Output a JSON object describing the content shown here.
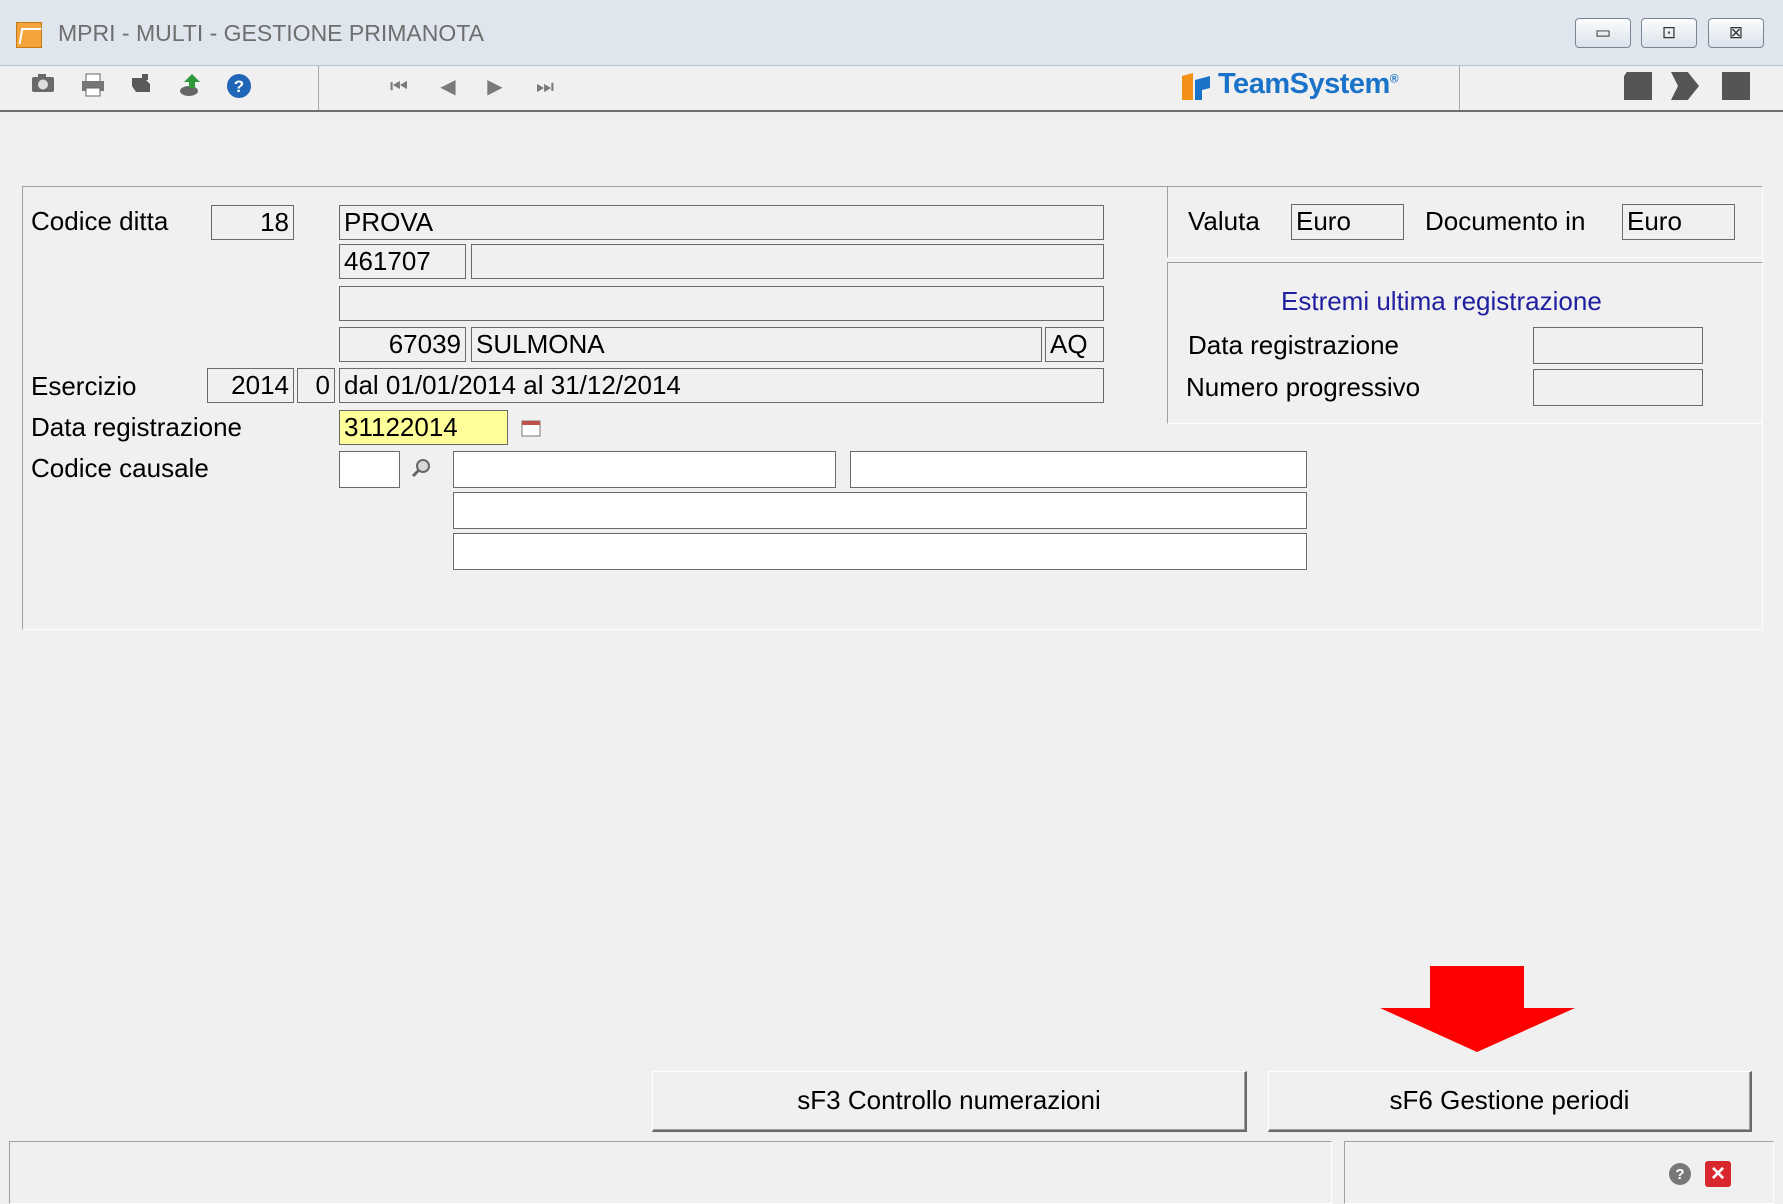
{
  "window": {
    "title": "MPRI  - MULTI -  GESTIONE PRIMANOTA",
    "minimize": "▭",
    "maximize": "⊡",
    "close": "⊠"
  },
  "toolbar": {
    "icons": [
      "camera-icon",
      "printer-icon",
      "stamp-icon",
      "export-icon",
      "help-icon"
    ],
    "nav": [
      "⏮",
      "◀",
      "▶",
      "⏭"
    ],
    "brand": "TeamSystem",
    "brand_mark": "®"
  },
  "ditta": {
    "label": "Codice ditta",
    "code": "18",
    "name": "PROVA",
    "code2": "461707",
    "code2_extra": "",
    "address": "",
    "cap": "67039",
    "city": "SULMONA",
    "province": "AQ"
  },
  "esercizio": {
    "label": "Esercizio",
    "year": "2014",
    "num": "0",
    "range": "dal 01/01/2014 al 31/12/2014"
  },
  "data_registrazione": {
    "label": "Data registrazione",
    "value": "31122014"
  },
  "causale": {
    "label": "Codice causale",
    "code": "",
    "desc1": "",
    "desc2": "",
    "desc3": "",
    "desc4": ""
  },
  "valuta": {
    "label": "Valuta",
    "value": "Euro",
    "doc_label": "Documento in",
    "doc_value": "Euro"
  },
  "ultima": {
    "title": "Estremi ultima registrazione",
    "data_label": "Data registrazione",
    "data_value": "",
    "numero_label": "Numero progressivo",
    "numero_value": ""
  },
  "buttons": {
    "controllo": "sF3 Controllo numerazioni",
    "gestione": "sF6 Gestione periodi"
  },
  "colors": {
    "arrow": "#ff0000",
    "accent_title": "#1f1f9f",
    "yellow_field": "#ffff99"
  },
  "status": {
    "help_icon": "?",
    "close_icon": "×"
  }
}
